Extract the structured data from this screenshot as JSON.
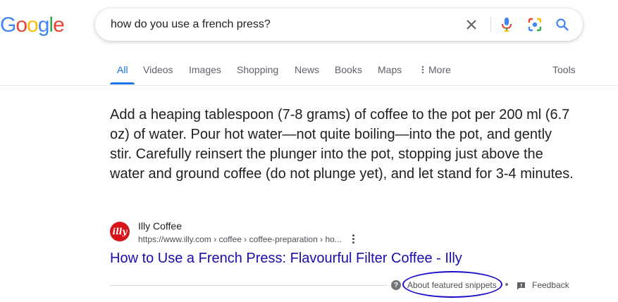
{
  "logo": {
    "text": "Google",
    "letters": [
      "G",
      "o",
      "o",
      "g",
      "l",
      "e"
    ]
  },
  "search": {
    "query": "how do you use a french press?"
  },
  "tabs": [
    {
      "label": "All"
    },
    {
      "label": "Videos"
    },
    {
      "label": "Images"
    },
    {
      "label": "Shopping"
    },
    {
      "label": "News"
    },
    {
      "label": "Books"
    },
    {
      "label": "Maps"
    },
    {
      "label": "More"
    }
  ],
  "tools_label": "Tools",
  "snippet": {
    "text": "Add a heaping tablespoon (7-8 grams) of coffee to the pot per 200 ml (6.7 oz) of water. Pour hot water—not quite boiling—into the pot, and gently stir. Carefully reinsert the plunger into the pot, stopping just above the water and ground coffee (do not plunge yet), and let stand for 3-4 minutes."
  },
  "source": {
    "favicon_text": "illy",
    "site_name": "Illy Coffee",
    "url": "https://www.illy.com › coffee › coffee-preparation › ho...",
    "title": "How to Use a French Press: Flavourful Filter Coffee - Illy"
  },
  "footer": {
    "about_label": "About featured snippets",
    "feedback_label": "Feedback"
  },
  "colors": {
    "link": "#1a0dab",
    "active_tab": "#1a73e8",
    "annotation_circle": "#1a0dcc",
    "illy_red": "#d7141a"
  }
}
